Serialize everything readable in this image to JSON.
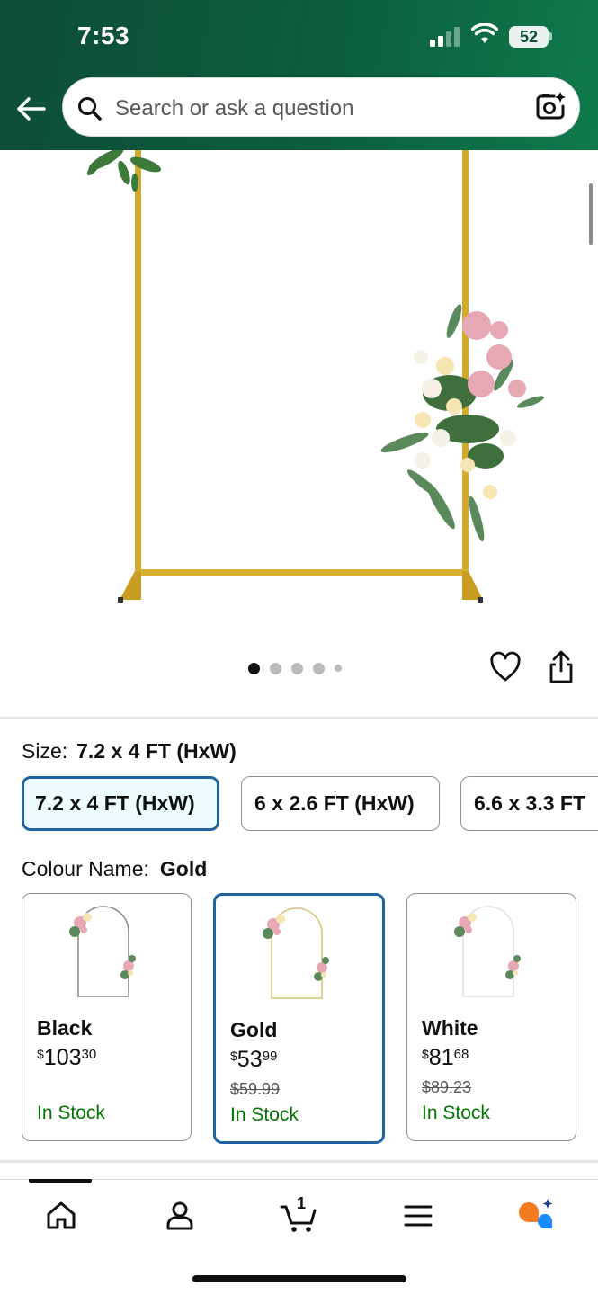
{
  "status_bar": {
    "time": "7:53",
    "battery": "52"
  },
  "search": {
    "placeholder": "Search or ask a question"
  },
  "gallery": {
    "image_count": 5,
    "active_index": 0
  },
  "size": {
    "label": "Size:",
    "selected": "7.2 x 4 FT (HxW)",
    "options": [
      "7.2 x 4 FT (HxW)",
      "6 x 2.6 FT (HxW)",
      "6.6 x 3.3 FT"
    ]
  },
  "colour": {
    "label": "Colour Name:",
    "selected": "Gold",
    "options": [
      {
        "name": "Black",
        "price_whole": "103",
        "price_fraction": "30",
        "currency": "$",
        "was": "",
        "stock": "In Stock",
        "frame_color": "#8a8a8a"
      },
      {
        "name": "Gold",
        "price_whole": "53",
        "price_fraction": "99",
        "currency": "$",
        "was": "$59.99",
        "stock": "In Stock",
        "frame_color": "#d9c07a"
      },
      {
        "name": "White",
        "price_whole": "81",
        "price_fraction": "68",
        "currency": "$",
        "was": "$89.23",
        "stock": "In Stock",
        "frame_color": "#e6e6e6"
      }
    ]
  },
  "bottom_nav": {
    "items": [
      "home-icon",
      "account-icon",
      "cart-icon",
      "menu-icon",
      "rufus-icon"
    ],
    "cart_count": "1"
  },
  "colors": {
    "header": "#0b5e3e",
    "selected_border": "#2162a1",
    "in_stock": "#007600",
    "frame_gold": "#d4aa2c"
  }
}
